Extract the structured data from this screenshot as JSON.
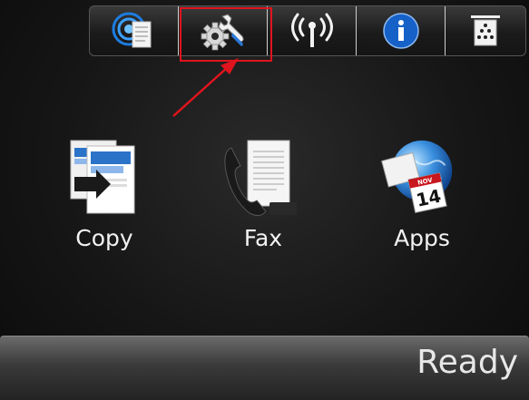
{
  "toolbar": {
    "buttons": [
      {
        "icon": "web-services-icon"
      },
      {
        "icon": "setup-wrench-gear-icon"
      },
      {
        "icon": "wireless-icon"
      },
      {
        "icon": "info-icon"
      },
      {
        "icon": "supplies-icon"
      }
    ],
    "highlight_color": "#e0141e"
  },
  "apps": [
    {
      "label": "Copy",
      "icon": "copy-icon"
    },
    {
      "label": "Fax",
      "icon": "fax-icon"
    },
    {
      "label": "Apps",
      "icon": "apps-globe-calendar-icon"
    }
  ],
  "apps_calendar": {
    "month": "NOV",
    "day": "14"
  },
  "status": {
    "text": "Ready"
  }
}
